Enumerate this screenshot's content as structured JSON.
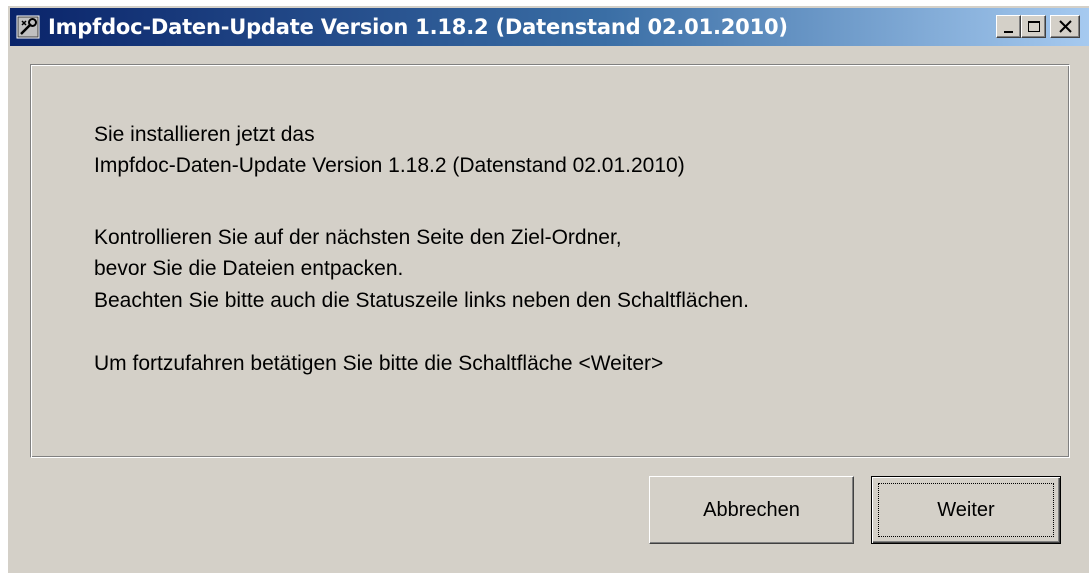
{
  "window": {
    "title": "Impfdoc-Daten-Update Version 1.18.2 (Datenstand 02.01.2010)"
  },
  "content": {
    "lines": [
      "Sie installieren jetzt das",
      "Impfdoc-Daten-Update Version 1.18.2 (Datenstand 02.01.2010)",
      "Kontrollieren Sie auf der nächsten Seite den Ziel-Ordner,",
      "bevor Sie die Dateien entpacken.",
      "Beachten Sie bitte auch die Statuszeile links neben den Schaltflächen.",
      "Um fortzufahren betätigen Sie bitte die Schaltfläche <Weiter>"
    ]
  },
  "buttons": {
    "cancel": "Abbrechen",
    "next": "Weiter"
  },
  "icons": {
    "app": "setup-wrench-icon",
    "minimize": "minimize-icon",
    "maximize": "maximize-icon",
    "close": "close-icon"
  },
  "colors": {
    "titlebar_start": "#0a246a",
    "titlebar_end": "#a6caf0",
    "face": "#d4d0c8"
  }
}
